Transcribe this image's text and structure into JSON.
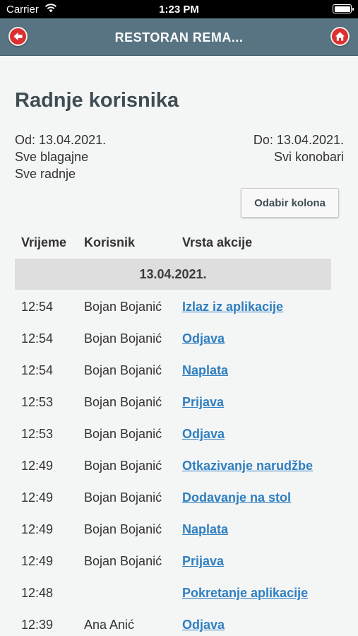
{
  "status_bar": {
    "carrier": "Carrier",
    "time": "1:23 PM"
  },
  "nav": {
    "title": "RESTORAN REMA..."
  },
  "page": {
    "title": "Radnje korisnika",
    "from": "Od: 13.04.2021.",
    "to": "Do: 13.04.2021.",
    "cash_registers": "Sve blagajne",
    "waiters": "Svi konobari",
    "actions_filter": "Sve radnje",
    "columns_button": "Odabir kolona"
  },
  "table": {
    "headers": [
      "Vrijeme",
      "Korisnik",
      "Vrsta akcije"
    ],
    "date_group": "13.04.2021.",
    "rows": [
      {
        "time": "12:54",
        "user": "Bojan Bojanić",
        "action": "Izlaz iz aplikacije"
      },
      {
        "time": "12:54",
        "user": "Bojan Bojanić",
        "action": "Odjava"
      },
      {
        "time": "12:54",
        "user": "Bojan Bojanić",
        "action": "Naplata"
      },
      {
        "time": "12:53",
        "user": "Bojan Bojanić",
        "action": "Prijava"
      },
      {
        "time": "12:53",
        "user": "Bojan Bojanić",
        "action": "Odjava"
      },
      {
        "time": "12:49",
        "user": "Bojan Bojanić",
        "action": "Otkazivanje narudžbe"
      },
      {
        "time": "12:49",
        "user": "Bojan Bojanić",
        "action": "Dodavanje na stol"
      },
      {
        "time": "12:49",
        "user": "Bojan Bojanić",
        "action": "Naplata"
      },
      {
        "time": "12:49",
        "user": "Bojan Bojanić",
        "action": "Prijava"
      },
      {
        "time": "12:48",
        "user": "",
        "action": "Pokretanje aplikacije"
      },
      {
        "time": "12:39",
        "user": "Ana Anić",
        "action": "Odjava"
      }
    ]
  },
  "colors": {
    "nav_bg": "#587482",
    "accent_red": "#dc2f2f",
    "link": "#2f7fc1"
  },
  "icons": {
    "back": "arrow-left-icon",
    "home": "home-icon",
    "wifi": "wifi-icon",
    "battery": "battery-icon"
  }
}
